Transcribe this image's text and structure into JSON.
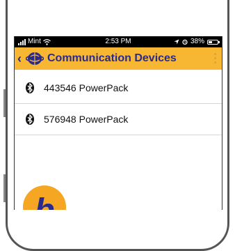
{
  "status_bar": {
    "carrier": "Mint",
    "time": "2:53 PM",
    "battery": "38%"
  },
  "app_bar": {
    "title": "Communication Devices",
    "back_icon": "chevron-left-icon",
    "logo_icon": "globe-logo-icon",
    "menu_icon": "more-vertical-icon"
  },
  "devices": [
    {
      "name": "443546 PowerPack",
      "icon": "bluetooth-icon"
    },
    {
      "name": "576948 PowerPack",
      "icon": "bluetooth-icon"
    }
  ],
  "badge": {
    "label": "b"
  },
  "colors": {
    "accent": "#F7B733",
    "title": "#2A2A8C",
    "badge": "#F5A623"
  }
}
